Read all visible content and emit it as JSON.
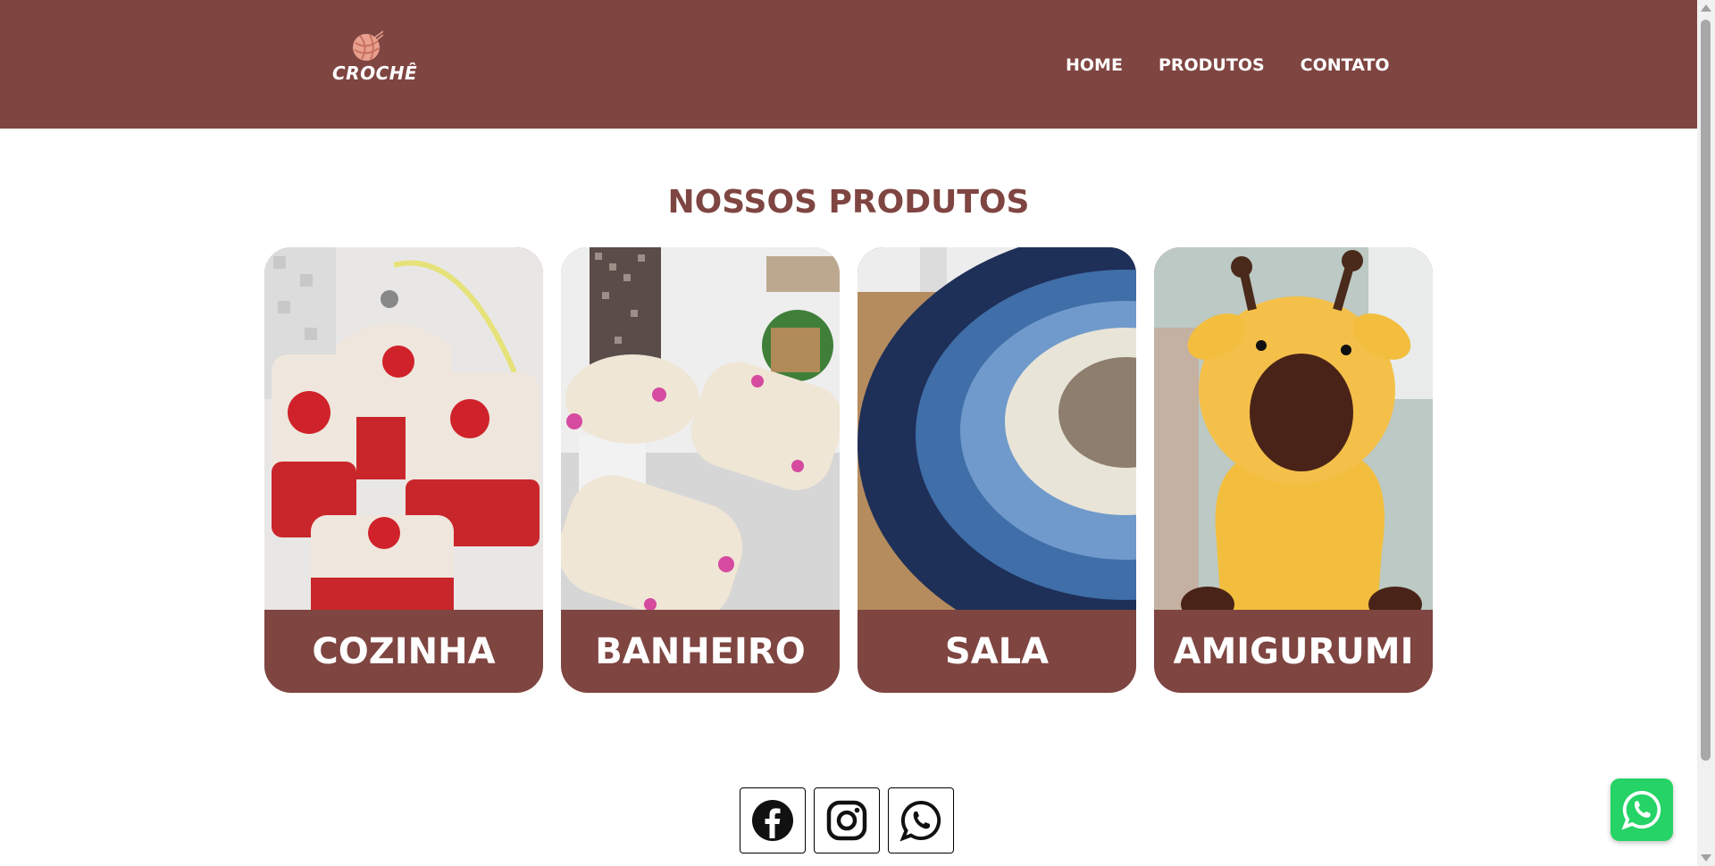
{
  "header": {
    "logo_text": "CROCHÊ",
    "logo_icon": "yarn-ball-icon",
    "nav": [
      {
        "label": "HOME"
      },
      {
        "label": "PRODUTOS"
      },
      {
        "label": "CONTATO"
      }
    ]
  },
  "main": {
    "title": "NOSSOS PRODUTOS",
    "cards": [
      {
        "label": "COZINHA",
        "image": "crochet-kitchen-covers"
      },
      {
        "label": "BANHEIRO",
        "image": "crochet-bathroom-set"
      },
      {
        "label": "SALA",
        "image": "crochet-round-rug"
      },
      {
        "label": "AMIGURUMI",
        "image": "crochet-giraffe-amigurumi"
      }
    ]
  },
  "footer": {
    "social": [
      {
        "icon": "facebook-icon"
      },
      {
        "icon": "instagram-icon"
      },
      {
        "icon": "whatsapp-icon"
      }
    ]
  },
  "floating": {
    "icon": "whatsapp-icon"
  },
  "colors": {
    "brand": "#7f4541",
    "whatsapp": "#25d366"
  }
}
